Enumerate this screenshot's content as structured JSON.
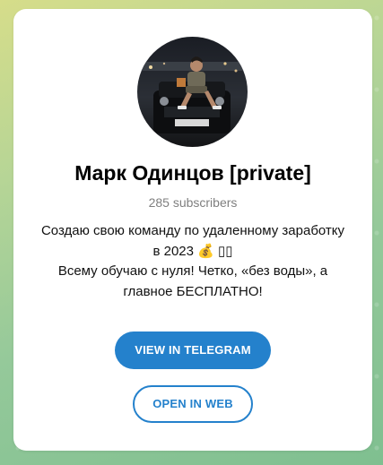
{
  "channel": {
    "title": "Марк Одинцов [private]",
    "subscribers": "285 subscribers",
    "description_lines": [
      "Создаю свою команду по удаленному заработку",
      "в 2023 💰 ▯▯",
      "Всему обучаю с нуля! Четко, «без воды», а",
      "главное БЕСПЛАТНО!"
    ]
  },
  "buttons": {
    "view_in_telegram": "VIEW IN TELEGRAM",
    "open_in_web": "OPEN IN WEB"
  },
  "colors": {
    "accent": "#2481cc",
    "muted_text": "#7f7f7f"
  },
  "icons": {
    "avatar": "channel-avatar-photo"
  }
}
